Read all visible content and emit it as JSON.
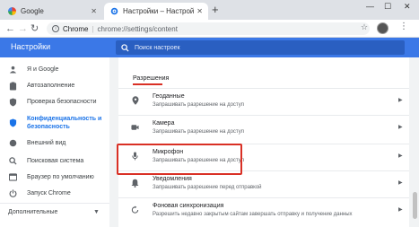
{
  "tabs": [
    {
      "label": "Google",
      "favicon": "google-g-icon",
      "active": false
    },
    {
      "label": "Настройки – Настройки сайтов",
      "favicon": "settings-gear-icon",
      "active": true
    }
  ],
  "window": {
    "minimize": "—",
    "maximize": "☐",
    "close": "✕"
  },
  "address_bar": {
    "site": "Chrome",
    "separator": "|",
    "url": "chrome://settings/content"
  },
  "header": {
    "title": "Настройки",
    "search_placeholder": "Поиск настроек"
  },
  "sidebar": {
    "items": [
      {
        "label": "Я и Google",
        "icon": "person-icon"
      },
      {
        "label": "Автозаполнение",
        "icon": "clipboard-icon"
      },
      {
        "label": "Проверка безопасности",
        "icon": "shield-check-icon"
      },
      {
        "label": "Конфиденциальность и безопасность",
        "icon": "shield-icon",
        "selected": true
      },
      {
        "label": "Внешний вид",
        "icon": "palette-icon"
      },
      {
        "label": "Поисковая система",
        "icon": "search-icon"
      },
      {
        "label": "Браузер по умолчанию",
        "icon": "browser-icon"
      },
      {
        "label": "Запуск Chrome",
        "icon": "power-icon"
      }
    ],
    "advanced": "Дополнительные"
  },
  "main": {
    "section_title": "Разрешения",
    "rows": [
      {
        "title": "Геоданные",
        "subtitle": "Запрашивать разрешение на доступ",
        "icon": "location-pin-icon"
      },
      {
        "title": "Камера",
        "subtitle": "Запрашивать разрешение на доступ",
        "icon": "camera-icon"
      },
      {
        "title": "Микрофон",
        "subtitle": "Запрашивать разрешение на доступ",
        "icon": "microphone-icon"
      },
      {
        "title": "Уведомления",
        "subtitle": "Запрашивать разрешение перед отправкой",
        "icon": "bell-icon"
      },
      {
        "title": "Фоновая синхронизация",
        "subtitle": "Разрешить недавно закрытым сайтам завершать отправку и получение данных",
        "icon": "sync-icon"
      }
    ]
  },
  "colors": {
    "accent": "#3b78e7",
    "selected": "#1a73e8",
    "highlight": "#d93025"
  }
}
